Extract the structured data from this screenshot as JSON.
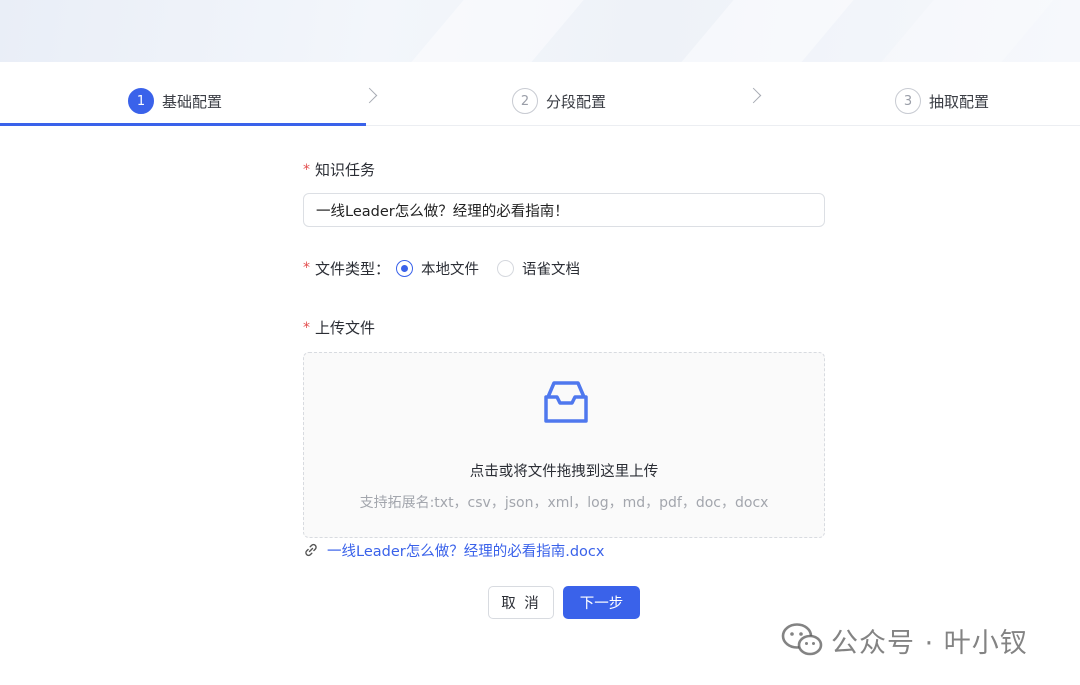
{
  "steps": [
    {
      "number": "1",
      "label": "基础配置",
      "state": "active"
    },
    {
      "number": "2",
      "label": "分段配置",
      "state": "pending"
    },
    {
      "number": "3",
      "label": "抽取配置",
      "state": "pending"
    }
  ],
  "form": {
    "task": {
      "required_mark": "*",
      "label": "知识任务",
      "value": "一线Leader怎么做？经理的必看指南！"
    },
    "file_type": {
      "required_mark": "*",
      "label": "文件类型：",
      "options": [
        {
          "label": "本地文件",
          "checked": true
        },
        {
          "label": "语雀文档",
          "checked": false
        }
      ]
    },
    "upload": {
      "required_mark": "*",
      "label": "上传文件",
      "drop_text": "点击或将文件拖拽到这里上传",
      "hint": "支持拓展名:txt，csv，json，xml，log，md，pdf，doc，docx",
      "icon": "inbox-icon",
      "uploaded_file": "一线Leader怎么做？经理的必看指南.docx"
    }
  },
  "actions": {
    "cancel_label": "取 消",
    "next_label": "下一步"
  },
  "watermark": {
    "text": "公众号 · 叶小钗",
    "icon": "wechat-icon"
  },
  "colors": {
    "accent": "#3a62ea",
    "required": "#e34d4d",
    "hint": "#a3a6ad"
  }
}
